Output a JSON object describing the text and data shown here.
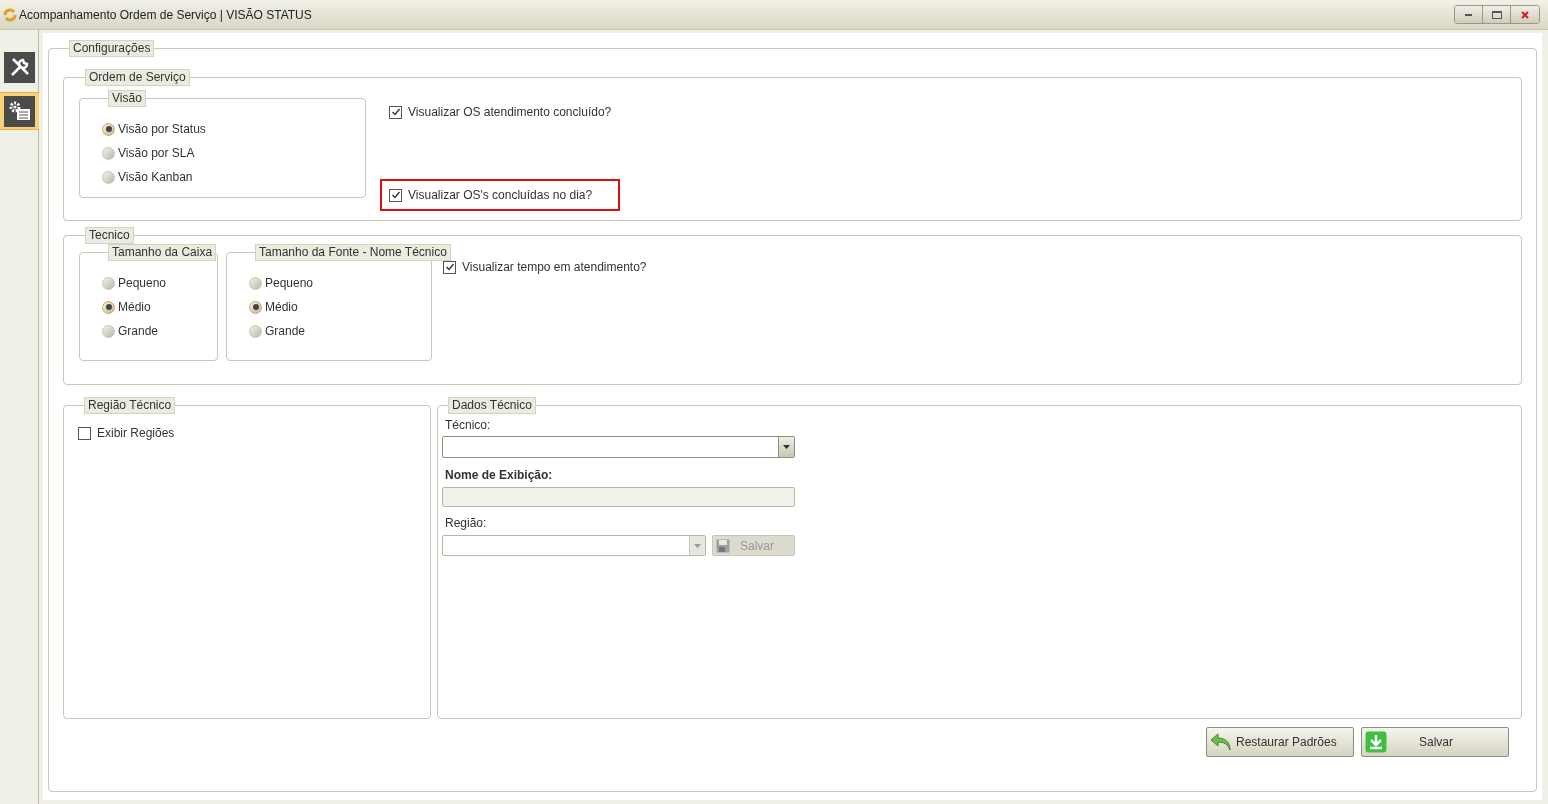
{
  "window": {
    "title": "Acompanhamento Ordem de Serviço | VISÃO STATUS"
  },
  "sidebar": {
    "items": [
      {
        "kind": "tools",
        "selected": false
      },
      {
        "kind": "settings",
        "selected": true
      }
    ]
  },
  "configuracoes": {
    "title": "Configurações",
    "ordem_servico": {
      "title": "Ordem de Serviço",
      "visao": {
        "title": "Visão",
        "options": [
          {
            "label": "Visão por Status",
            "selected": true
          },
          {
            "label": "Visão por SLA",
            "selected": false
          },
          {
            "label": "Visão Kanban",
            "selected": false
          }
        ]
      },
      "checkboxes": [
        {
          "label": "Visualizar OS atendimento concluído?",
          "checked": true,
          "highlighted": false
        },
        {
          "label": "Visualizar OS's concluídas no dia?",
          "checked": true,
          "highlighted": true
        }
      ]
    },
    "tecnico": {
      "title": "Tecnico",
      "groups": [
        {
          "title": "Tamanho da Caixa",
          "options": [
            {
              "label": "Pequeno",
              "selected": false
            },
            {
              "label": "Médio",
              "selected": true
            },
            {
              "label": "Grande",
              "selected": false
            }
          ]
        },
        {
          "title": "Tamanho da Fonte - Nome Técnico",
          "options": [
            {
              "label": "Pequeno",
              "selected": false
            },
            {
              "label": "Médio",
              "selected": true
            },
            {
              "label": "Grande",
              "selected": false
            }
          ]
        }
      ],
      "checkboxes": [
        {
          "label": "Visualizar tempo em atendimento?",
          "checked": true
        }
      ]
    },
    "regiao_tecnico": {
      "title": "Região Técnico",
      "checkbox": {
        "label": "Exibir Regiões",
        "checked": false
      }
    },
    "dados_tecnico": {
      "title": "Dados Técnico",
      "tecnico_label": "Técnico:",
      "nome_label": "Nome de Exibição:",
      "regiao_label": "Região:",
      "salvar_button": {
        "label": "Salvar",
        "disabled": true
      }
    }
  },
  "buttons": [
    {
      "kind": "restore",
      "label": "Restaurar Padrões"
    },
    {
      "kind": "save",
      "label": "Salvar"
    }
  ]
}
